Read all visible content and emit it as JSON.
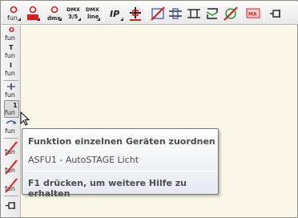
{
  "toolbar": {
    "items": [
      "fun-outlet-icon",
      "fun-outlet-red-icon",
      "dmx-outlet-icon",
      "dmx-3-5-icon",
      "dmx-line-icon",
      "ip-address-icon",
      "add-device-icon",
      "cross-fun-icon",
      "swap-horizontal-icon",
      "connector-icon",
      "replace-icon",
      "delete-fun-icon",
      "ma-icon",
      "pin-icon"
    ],
    "labels": {
      "dmx_top": "DMX",
      "dmx_35": "3/5",
      "dmx_line": "line",
      "ip": "IP",
      "ma": "MA"
    }
  },
  "sidebar": {
    "fun_label": "fun",
    "items": [
      "fun-o-icon",
      "fun-t-icon",
      "fun-i-icon",
      "fun-plus-icon",
      "fun-one-icon",
      "fun-assign-icon",
      "fun-cross-icon",
      "fun-cross-2-icon",
      "fun-cross-3-icon",
      "pin-icon"
    ],
    "markers": [
      "O",
      "T",
      "I",
      "1"
    ]
  },
  "tooltip": {
    "title": "Funktion einzelnen Geräten zuordnen",
    "body": "ASFU1 - AutoSTAGE Licht",
    "help": "F1 drücken, um weitere Hilfe zu erhalten"
  },
  "colors": {
    "accent_red": "#d22020",
    "text": "#4c4c4c",
    "canvas": "#fbf8ea"
  }
}
